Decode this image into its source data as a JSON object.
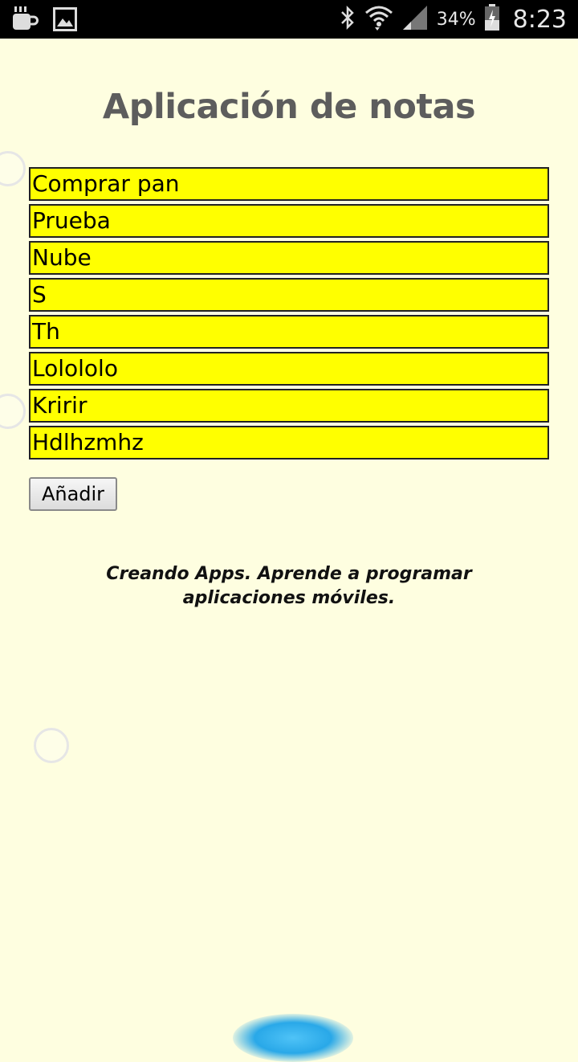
{
  "status_bar": {
    "icons_left": [
      "coffee-icon",
      "image-icon"
    ],
    "icons_right": [
      "bluetooth-icon",
      "wifi-icon",
      "signal-icon",
      "battery-icon"
    ],
    "battery_percent": "34%",
    "time": "8:23"
  },
  "app": {
    "title": "Aplicación de notas",
    "notes": [
      "Comprar pan",
      "Prueba",
      "Nube",
      "S",
      "Th",
      "Lolololo",
      "Kririr",
      "Hdlhzmhz"
    ],
    "add_button_label": "Añadir",
    "footer_text": "Creando Apps. Aprende a programar aplicaciones móviles."
  },
  "colors": {
    "background": "#fefee0",
    "note_background": "#ffff00",
    "title_color": "#5d5d5d"
  }
}
